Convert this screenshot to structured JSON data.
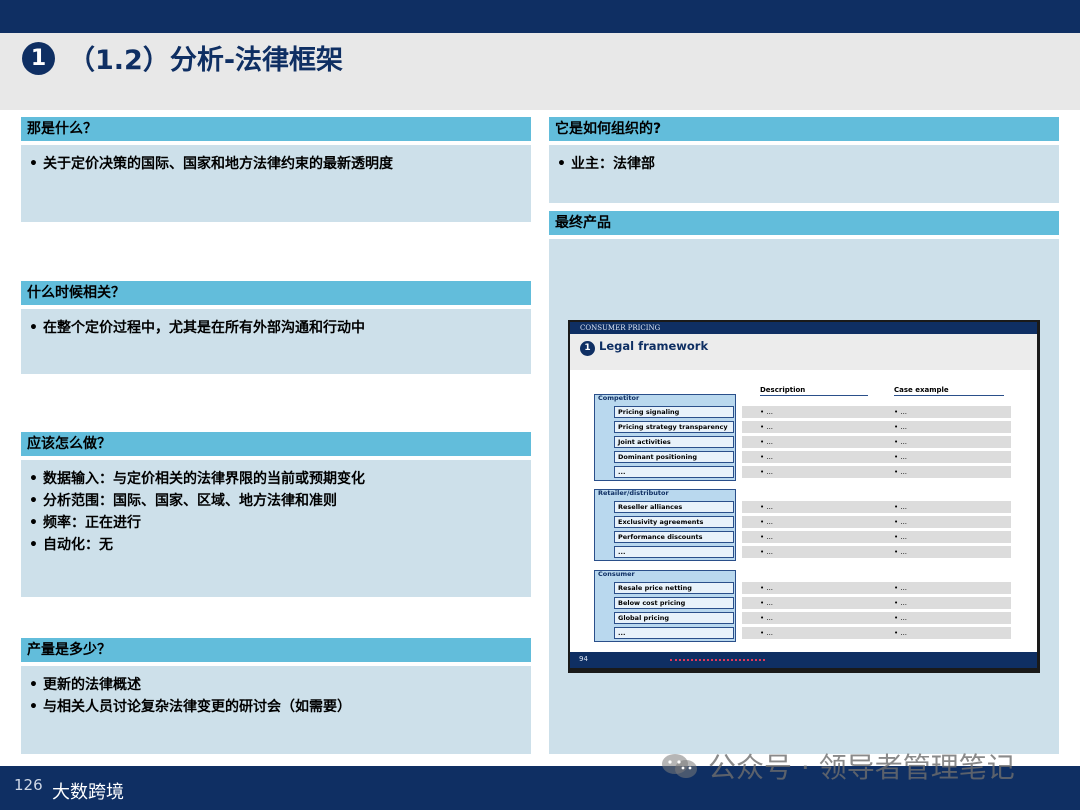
{
  "header": {
    "number": "1",
    "title": "（1.2）分析-法律框架"
  },
  "left": [
    {
      "heading": "那是什么？",
      "bullets": [
        "关于定价决策的国际、国家和地方法律约束的最新透明度"
      ]
    },
    {
      "heading": "什么时候相关？",
      "bullets": [
        "在整个定价过程中，尤其是在所有外部沟通和行动中"
      ]
    },
    {
      "heading": "应该怎么做？",
      "bullets": [
        "数据输入：与定价相关的法律界限的当前或预期变化",
        "分析范围：国际、国家、区域、地方法律和准则",
        "频率：正在进行",
        "自动化：无"
      ]
    },
    {
      "heading": "产量是多少？",
      "bullets": [
        "更新的法律概述",
        "与相关人员讨论复杂法律变更的研讨会（如需要）"
      ]
    }
  ],
  "right": {
    "org": {
      "heading": "它是如何组织的?",
      "bullets": [
        "业主：法律部"
      ]
    },
    "product": {
      "heading": "最终产品"
    }
  },
  "thumbnail": {
    "topbar": "CONSUMER PRICING",
    "number": "1",
    "title": "Legal framework",
    "col_description": "Description",
    "col_case": "Case example",
    "cell_text": "• ...",
    "page": "94",
    "groups": [
      {
        "label": "Competitor",
        "items": [
          "Pricing signaling",
          "Pricing strategy transparency",
          "Joint activities",
          "Dominant positioning",
          "..."
        ]
      },
      {
        "label": "Retailer/distributor",
        "items": [
          "Reseller alliances",
          "Exclusivity agreements",
          "Performance discounts",
          "..."
        ]
      },
      {
        "label": "Consumer",
        "items": [
          "Resale price netting",
          "Below cost pricing",
          "Global pricing",
          "..."
        ]
      }
    ]
  },
  "footer": {
    "page_number": "126",
    "brand": "大数跨境",
    "watermark": "公众号 · 领导者管理笔记"
  },
  "colors": {
    "navy": "#0f2f63",
    "section_header": "#62bddb",
    "section_body": "#cde0ea",
    "title_band": "#e8e8e8"
  }
}
